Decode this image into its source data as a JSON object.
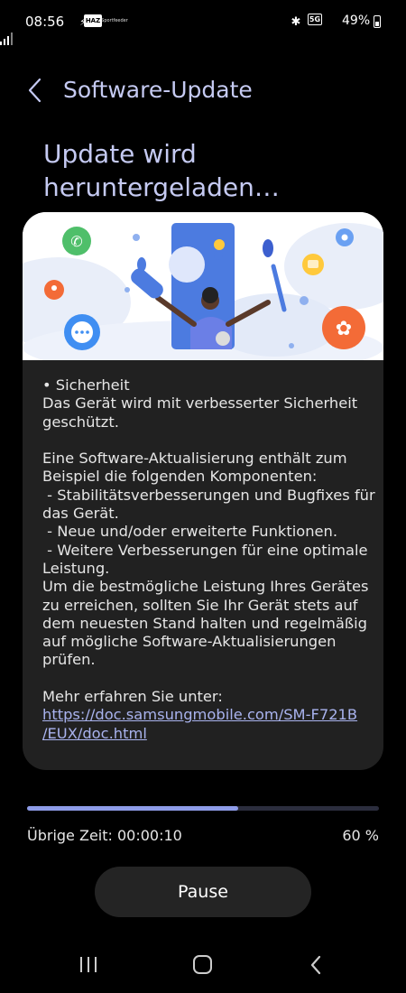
{
  "status_bar": {
    "time": "08:56",
    "left_icons": [
      "flash-app-icon",
      "haz-app-icon",
      "news-app-icon"
    ],
    "haz_label": "HAZ",
    "small_label": "Sportfeeder",
    "right_icons": [
      "bluetooth-icon",
      "5g-icon",
      "signal-icon",
      "battery-icon"
    ],
    "network": "5G",
    "battery": "49%"
  },
  "header": {
    "back_icon": "chevron-left-icon",
    "title": "Software-Update"
  },
  "headline": "Update wird heruntergeladen…",
  "card": {
    "illustration": "update-illustration",
    "lines": [
      "• Sicherheit",
      "Das Gerät wird mit verbesserter Sicherheit",
      "geschützt.",
      "",
      "Eine Software-Aktualisierung enthält zum",
      "Beispiel die folgenden Komponenten:",
      " - Stabilitätsverbesserungen und Bugfixes für",
      "das Gerät.",
      " - Neue und/oder erweiterte Funktionen.",
      " - Weitere Verbesserungen für eine optimale",
      "Leistung.",
      "Um die bestmögliche Leistung Ihres Gerätes",
      "zu erreichen, sollten Sie Ihr Gerät stets auf",
      "dem neuesten Stand halten und regelmäßig",
      "auf mögliche Software-Aktualisierungen",
      "prüfen.",
      "",
      "Mehr erfahren Sie unter:"
    ],
    "link_lines": [
      "https://doc.samsungmobile.com/SM-F721B",
      "/EUX/doc.html"
    ]
  },
  "progress": {
    "value": 0.6,
    "time_left": "Übrige Zeit: 00:00:10",
    "percent": "60 %",
    "track_color": "#2b2d3d",
    "fill_color": "#8e9ce8"
  },
  "pause_label": "Pause",
  "nav": {
    "recents_icon": "recents-icon",
    "home_icon": "home-icon",
    "back_icon": "back-icon"
  },
  "colors": {
    "background": "#000000",
    "accent": "#c5caf2",
    "card": "#212121",
    "link": "#a9b3ee"
  }
}
